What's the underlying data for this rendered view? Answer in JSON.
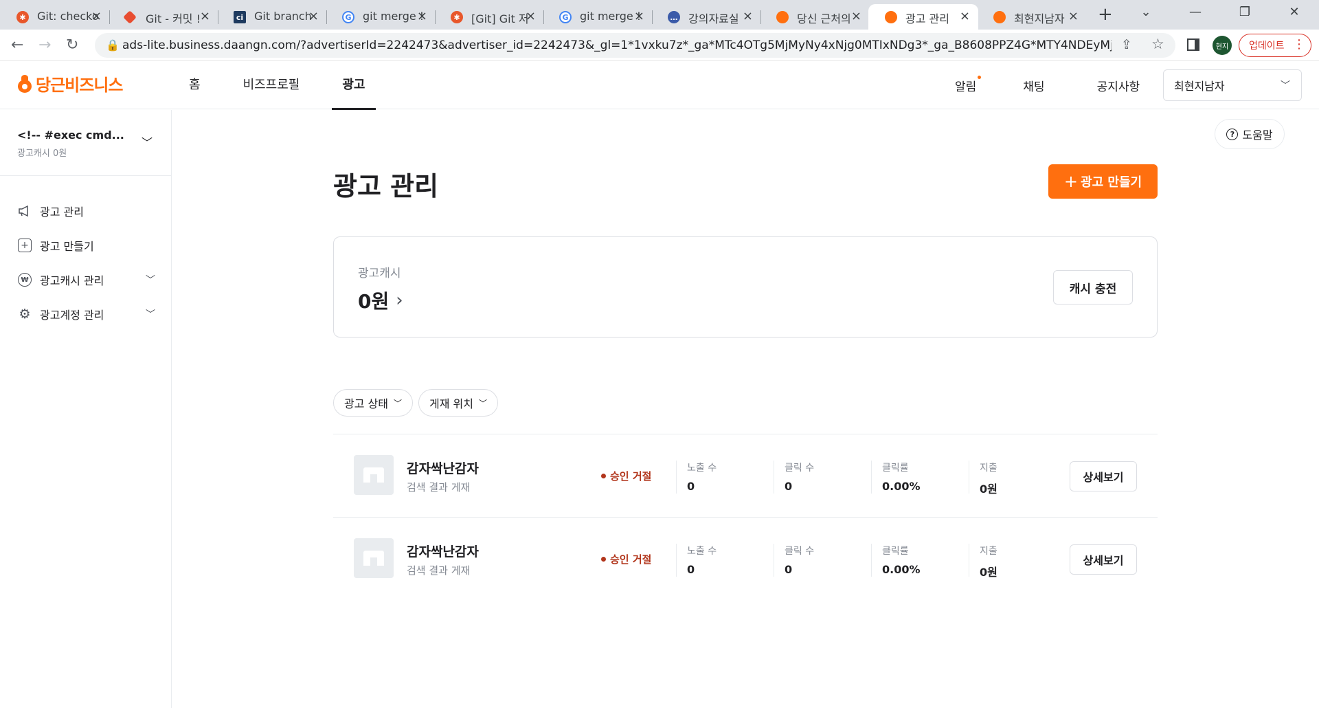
{
  "browser": {
    "tabs": [
      {
        "title": "Git: checko",
        "favicon": "git-icon",
        "color": "#e8572b"
      },
      {
        "title": "Git - 커밋 !",
        "favicon": "git-diamond-icon",
        "color": "#e84d31"
      },
      {
        "title": "Git branch",
        "favicon": "ci-icon",
        "color": "#1e3a5f"
      },
      {
        "title": "git merge !",
        "favicon": "google-icon",
        "color": "#4285f4"
      },
      {
        "title": "[Git] Git 저",
        "favicon": "git-icon",
        "color": "#e8572b"
      },
      {
        "title": "git merge !",
        "favicon": "google-icon",
        "color": "#4285f4"
      },
      {
        "title": "강의자료실",
        "favicon": "chat-icon",
        "color": "#3b5ba9"
      },
      {
        "title": "당신 근처의",
        "favicon": "carrot-icon",
        "color": "#ff6f0f"
      },
      {
        "title": "광고 관리",
        "favicon": "carrot-icon",
        "color": "#ff6f0f",
        "active": true
      },
      {
        "title": "최현지남자",
        "favicon": "carrot-icon",
        "color": "#ff6f0f"
      }
    ],
    "url": "ads-lite.business.daangn.com/?advertiserId=2242473&advertiser_id=2242473&_gl=1*1vxku7z*_ga*MTc4OTg5MjMyNy4xNjg0MTIxNDg3*_ga_B8608PPZ4G*MTY4NDEyMjIzNy4xLjEuM...",
    "profile_label": "현지",
    "update_label": "업데이트"
  },
  "header": {
    "logo_text": "당근비즈니스",
    "nav": [
      "홈",
      "비즈프로필",
      "광고"
    ],
    "active_nav": "광고",
    "links": {
      "alarm": "알림",
      "chat": "채팅",
      "notice": "공지사항"
    },
    "business_select": "최현지남자"
  },
  "sidebar": {
    "account_name": "<!-- #exec cmd...",
    "account_cash": "광고캐시 0원",
    "items": [
      {
        "label": "광고 관리",
        "icon": "megaphone-icon"
      },
      {
        "label": "광고 만들기",
        "icon": "plus-square-icon"
      },
      {
        "label": "광고캐시 관리",
        "icon": "won-circle-icon"
      },
      {
        "label": "광고계정 관리",
        "icon": "gear-icon"
      }
    ]
  },
  "main": {
    "help_label": "도움말",
    "title": "광고 관리",
    "create_label": "광고 만들기",
    "cash": {
      "label": "광고캐시",
      "amount": "0원",
      "charge_label": "캐시 충전"
    },
    "filters": [
      "광고 상태",
      "게재 위치"
    ],
    "ads": [
      {
        "title": "감자싹난감자",
        "placement": "검색 결과 게재",
        "status": "승인 거절",
        "impressions_label": "노출 수",
        "impressions": "0",
        "clicks_label": "클릭 수",
        "clicks": "0",
        "ctr_label": "클릭률",
        "ctr": "0.00%",
        "spend_label": "지출",
        "spend": "0원",
        "detail_label": "상세보기"
      },
      {
        "title": "감자싹난감자",
        "placement": "검색 결과 게재",
        "status": "승인 거절",
        "impressions_label": "노출 수",
        "impressions": "0",
        "clicks_label": "클릭 수",
        "clicks": "0",
        "ctr_label": "클릭률",
        "ctr": "0.00%",
        "spend_label": "지출",
        "spend": "0원",
        "detail_label": "상세보기"
      }
    ]
  },
  "colors": {
    "brand": "#ff6f0f",
    "reject": "#b2361c",
    "muted": "#868b94"
  }
}
